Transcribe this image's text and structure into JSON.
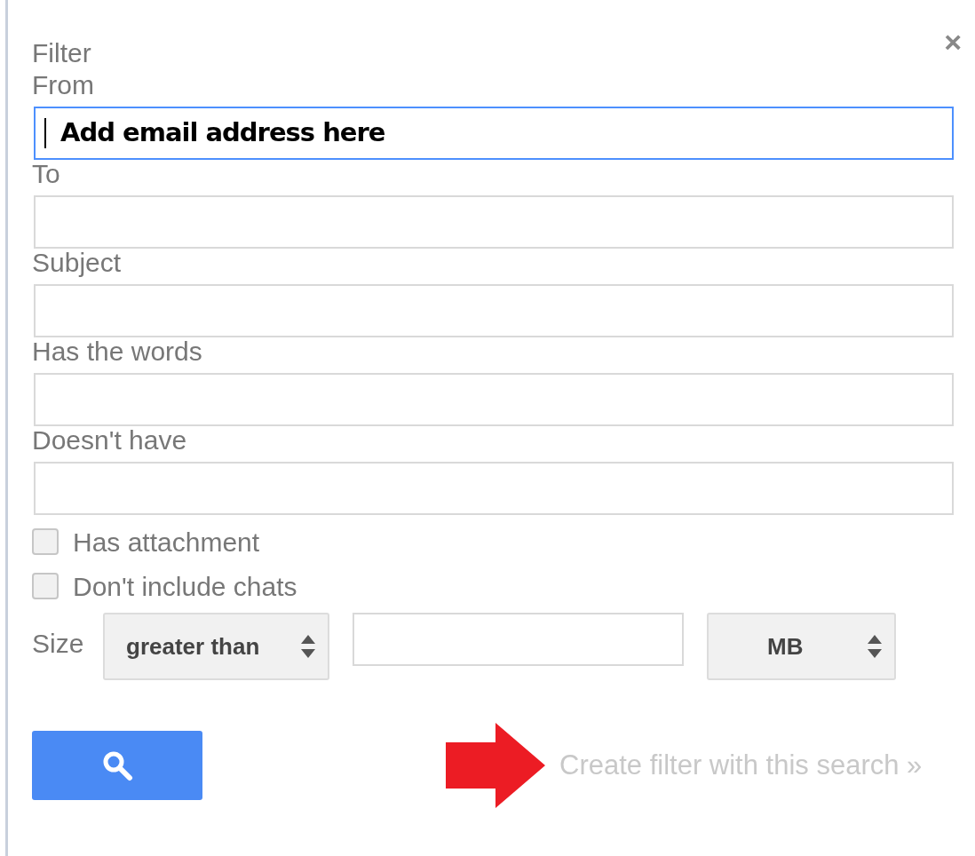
{
  "dialog": {
    "title": "Filter",
    "close": "×"
  },
  "fields": [
    {
      "label": "From",
      "value": "Add email address here",
      "focused": true
    },
    {
      "label": "To",
      "focused": false
    },
    {
      "label": "Subject",
      "focused": false
    },
    {
      "label": "Has the words",
      "focused": false
    },
    {
      "label": "Doesn't have",
      "focused": false
    }
  ],
  "checkboxes": [
    {
      "label": "Has attachment",
      "checked": false
    },
    {
      "label": "Don't include chats",
      "checked": false
    }
  ],
  "size": {
    "label": "Size",
    "comparison": "greater than",
    "unit": "MB"
  },
  "create_filter": {
    "label": "Create filter with this search »",
    "disabled": true
  }
}
